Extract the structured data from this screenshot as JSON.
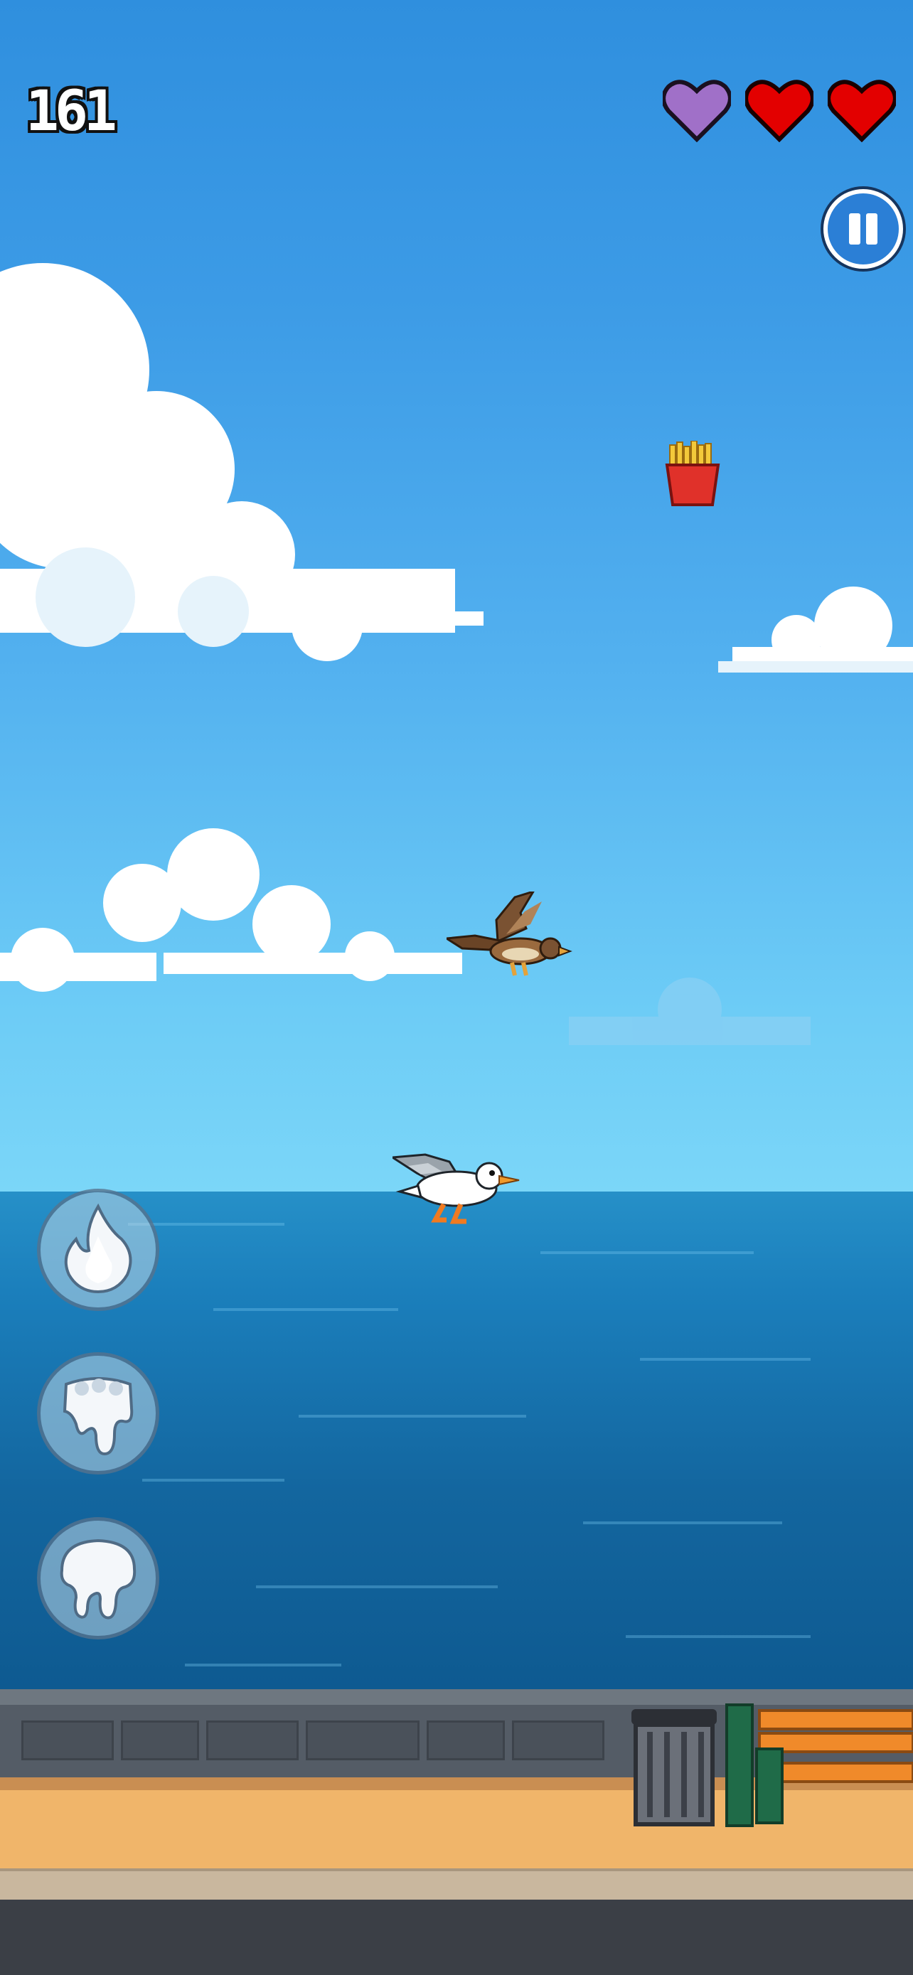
{
  "hud": {
    "score": "161",
    "lives": [
      {
        "state": "shield",
        "color": "#a070c8"
      },
      {
        "state": "full",
        "color": "#e30000"
      },
      {
        "state": "full",
        "color": "#e30000"
      }
    ],
    "pause_icon": "pause-icon"
  },
  "abilities": [
    {
      "name": "fire-power-icon"
    },
    {
      "name": "triple-drop-icon"
    },
    {
      "name": "splat-drop-icon"
    }
  ],
  "sprites": {
    "player": "seagull-icon",
    "enemy": "hawk-icon",
    "pickup": "french-fries-icon",
    "props": [
      "trash-can-icon",
      "bench-icon"
    ]
  },
  "colors": {
    "heart_full": "#e30000",
    "heart_shield": "#a070c8",
    "pause_button": "#2b7fd6"
  }
}
